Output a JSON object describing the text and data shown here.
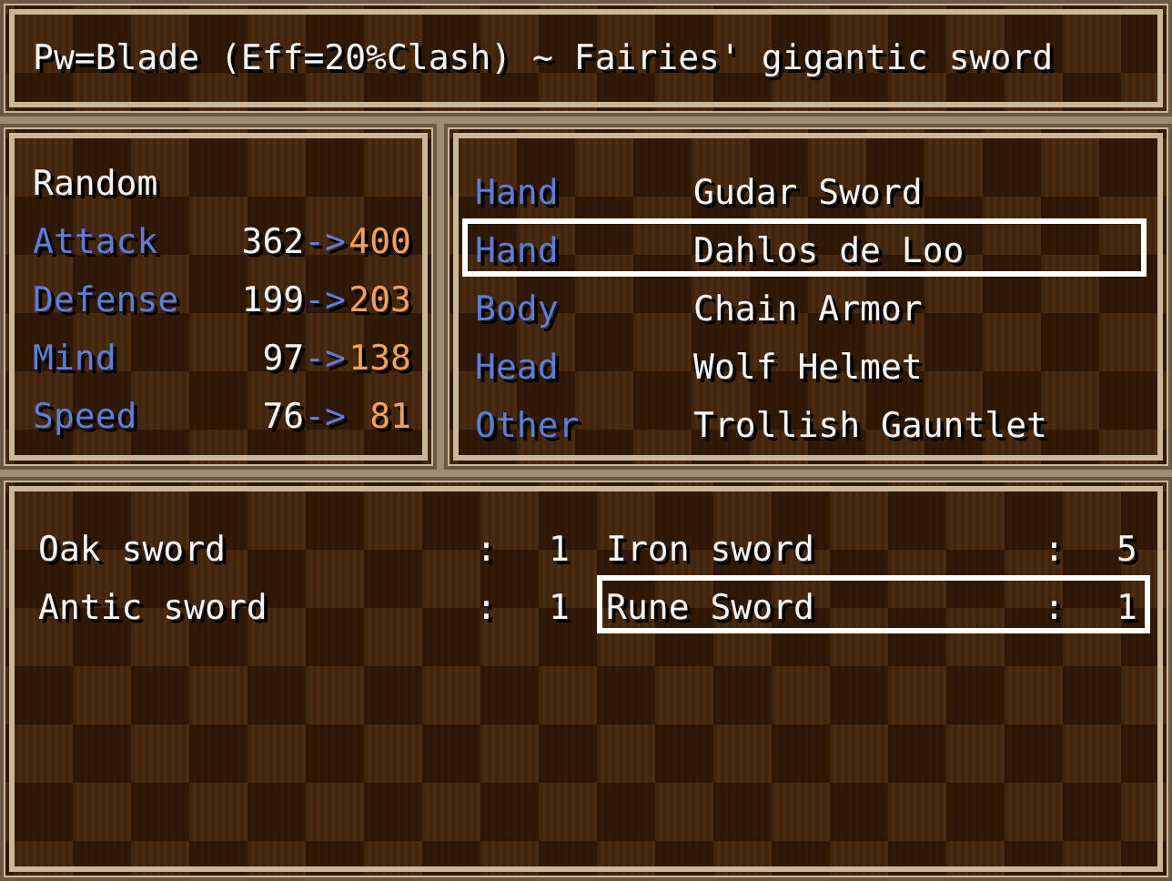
{
  "help": {
    "text": "Pw=Blade (Eff=20%Clash) ~ Fairies' gigantic sword"
  },
  "status": {
    "name": "Random",
    "stats": [
      {
        "label": "Attack",
        "current": "362",
        "arrow": "->",
        "new": "400"
      },
      {
        "label": "Defense",
        "current": "199",
        "arrow": "->",
        "new": "203"
      },
      {
        "label": "Mind",
        "current": "97",
        "arrow": "->",
        "new": "138"
      },
      {
        "label": "Speed",
        "current": "76",
        "arrow": "->",
        "new": "81"
      }
    ]
  },
  "equipment": [
    {
      "slot": "Hand",
      "item": "Gudar Sword",
      "selected": false
    },
    {
      "slot": "Hand",
      "item": "Dahlos de Loo",
      "selected": true
    },
    {
      "slot": "Body",
      "item": "Chain Armor",
      "selected": false
    },
    {
      "slot": "Head",
      "item": "Wolf Helmet",
      "selected": false
    },
    {
      "slot": "Other",
      "item": "Trollish Gauntlet",
      "selected": false
    }
  ],
  "items": [
    {
      "name": "Oak sword",
      "colon": ":",
      "count": "1",
      "selected": false
    },
    {
      "name": "Iron sword",
      "colon": ":",
      "count": "5",
      "selected": false
    },
    {
      "name": "Antic sword",
      "colon": ":",
      "count": "1",
      "selected": false
    },
    {
      "name": "Rune Sword",
      "colon": ":",
      "count": "1",
      "selected": true
    }
  ]
}
